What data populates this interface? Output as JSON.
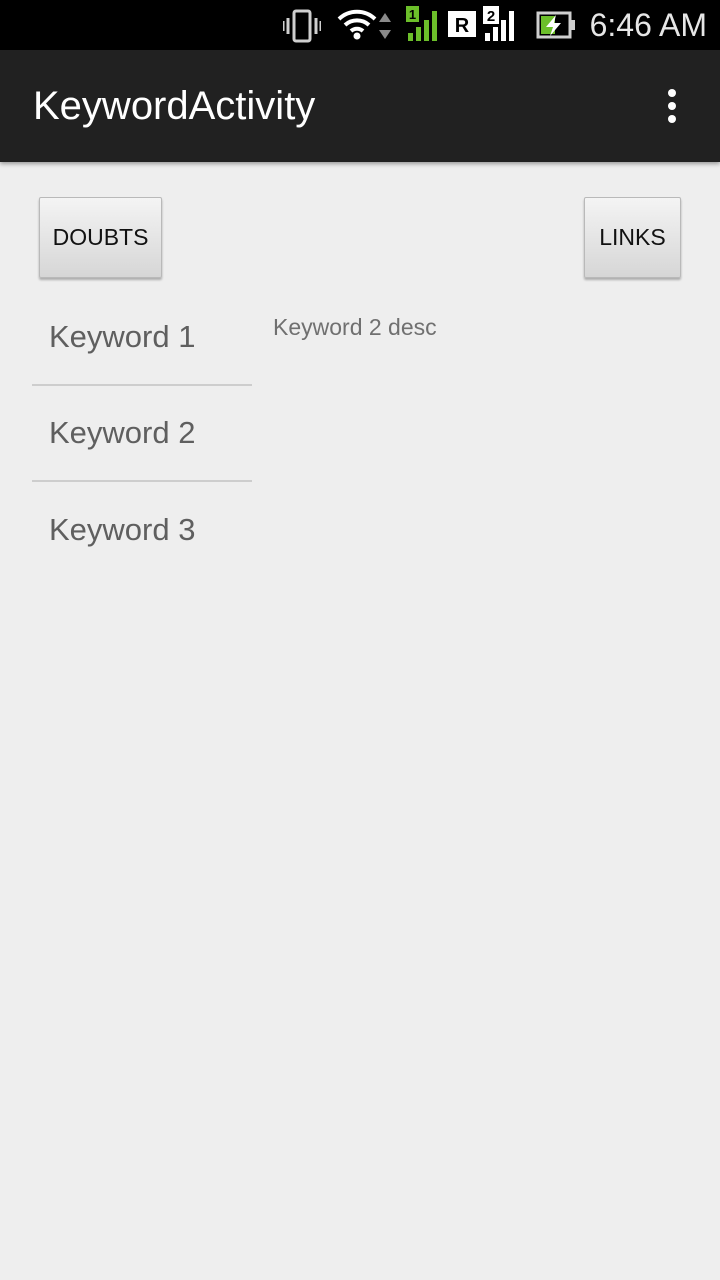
{
  "status_bar": {
    "time": "6:46 AM",
    "icons": [
      "vibrate-icon",
      "wifi-icon",
      "data-arrows-icon",
      "sim1-signal-icon",
      "roaming-icon",
      "sim2-signal-icon",
      "battery-charging-icon"
    ],
    "sim1_label": "1",
    "sim2_label": "2",
    "roaming_label": "R",
    "accent_green": "#6cbf2a"
  },
  "action_bar": {
    "title": "KeywordActivity",
    "overflow_icon": "more-vert-icon"
  },
  "buttons": {
    "doubts_label": "DOUBTS",
    "links_label": "LINKS"
  },
  "keywords": [
    {
      "label": "Keyword 1"
    },
    {
      "label": "Keyword 2"
    },
    {
      "label": "Keyword 3"
    }
  ],
  "description": "Keyword 2 desc"
}
